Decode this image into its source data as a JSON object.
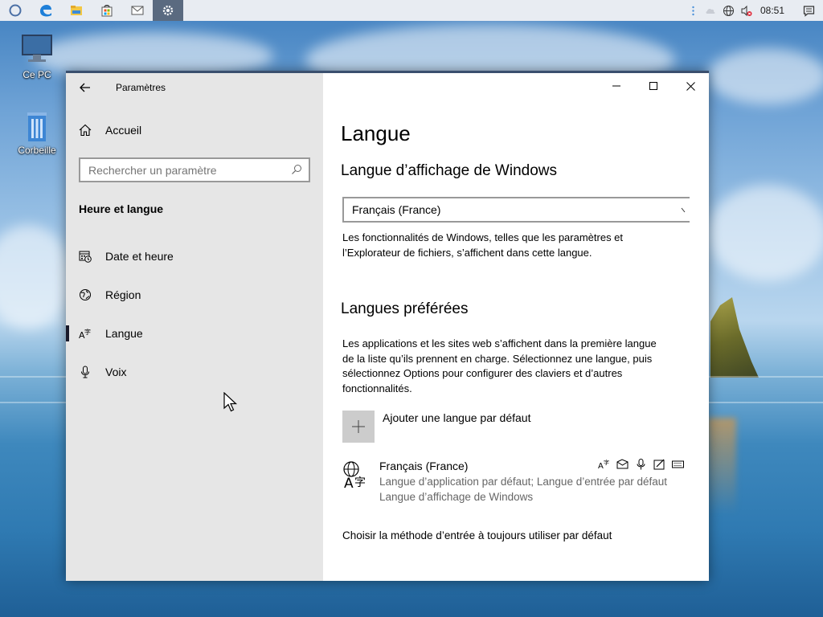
{
  "taskbar": {
    "apps": [
      {
        "name": "cortana-icon"
      },
      {
        "name": "edge-icon"
      },
      {
        "name": "file-explorer-icon"
      },
      {
        "name": "store-icon"
      },
      {
        "name": "mail-icon"
      },
      {
        "name": "settings-icon",
        "active": true
      }
    ],
    "clock": "08:51"
  },
  "desktop": {
    "icons": [
      {
        "label": "Ce PC"
      },
      {
        "label": "Corbeille"
      }
    ]
  },
  "window": {
    "app_title": "Paramètres",
    "nav": {
      "home_label": "Accueil",
      "search_placeholder": "Rechercher un paramètre",
      "section_title": "Heure et langue",
      "items": [
        {
          "label": "Date et heure",
          "icon": "calendar-clock-icon"
        },
        {
          "label": "Région",
          "icon": "globe-icon"
        },
        {
          "label": "Langue",
          "icon": "language-icon",
          "selected": true
        },
        {
          "label": "Voix",
          "icon": "microphone-icon"
        }
      ]
    },
    "content": {
      "page_title": "Langue",
      "display_language": {
        "heading": "Langue d’affichage de Windows",
        "selected": "Français (France)",
        "description_line1": "Les fonctionnalités de Windows, telles que les paramètres et",
        "description_line2": "l’Explorateur de fichiers, s’affichent dans cette langue."
      },
      "preferred": {
        "heading": "Langues préférées",
        "description_line1": "Les applications et les sites web s’affichent dans la première langue",
        "description_line2": "de la liste qu’ils prennent en charge. Sélectionnez une langue, puis",
        "description_line3": "sélectionnez Options pour configurer des claviers et d’autres",
        "description_line4": "fonctionnalités.",
        "add_label": "Ajouter une langue par défaut",
        "language": {
          "name": "Français (France)",
          "desc_line1": "Langue d’application par défaut; Langue d’entrée par défaut",
          "desc_line2": "Langue d’affichage de Windows",
          "features": [
            "display-language-icon",
            "speech-icon",
            "microphone-icon",
            "handwriting-icon",
            "keyboard-icon"
          ]
        }
      },
      "link": "Choisir la méthode d’entrée à toujours utiliser par défaut"
    }
  }
}
